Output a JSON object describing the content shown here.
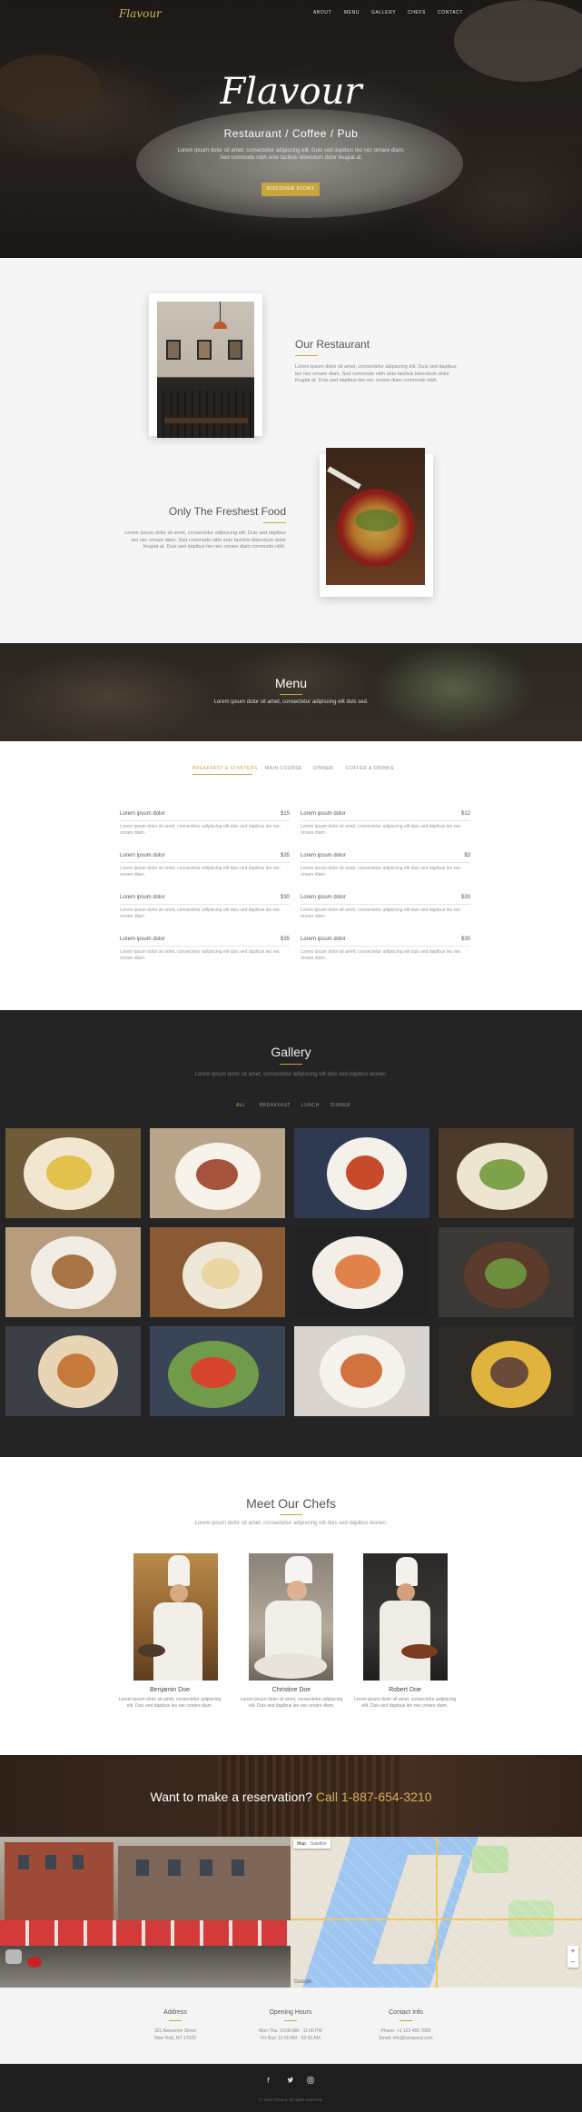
{
  "brand": {
    "logo": "Flavour",
    "accent": "#c9a53f"
  },
  "nav": {
    "items": [
      "ABOUT",
      "MENU",
      "GALLERY",
      "CHEFS",
      "CONTACT"
    ]
  },
  "hero": {
    "title": "Flavour",
    "subtitle": "Restaurant  /  Coffee  /  Pub",
    "description": "Lorem ipsum dolor sit amet, consectetur adipiscing elit. Duis sed dapibus leo nec ornare diam. Sed commodo nibh ante facilisis bibendum dolor feugiat at.",
    "button": "DISCOVER STORY"
  },
  "about": {
    "restaurant": {
      "heading": "Our Restaurant",
      "text": "Lorem ipsum dolor sit amet, consectetur adipiscing elit. Duis sed dapibus leo nec ornare diam. Sed commodo nibh ante facilisis bibendum dolor feugiat at. Duis sed dapibus leo nec ornare diam commodo nibh."
    },
    "food": {
      "heading": "Only The Freshest Food",
      "text": "Lorem ipsum dolor sit amet, consectetur adipiscing elit. Duis sed dapibus leo nec ornare diam. Sed commodo nibh ante facilisis bibendum dolor feugiat at. Duis sed dapibus leo nec ornare diam commodo nibh."
    }
  },
  "menu_banner": {
    "title": "Menu",
    "subtitle": "Lorem ipsum dolor sit amet, consectetur adipiscing elit duis sed."
  },
  "menu": {
    "tabs": [
      "BREAKFAST & STARTERS",
      "MAIN COURSE",
      "DINNER",
      "COFFEE & DRINKS"
    ],
    "active_tab": "BREAKFAST & STARTERS",
    "left": [
      {
        "name": "Lorem ipsum dolor",
        "price": "$15",
        "desc": "Lorem ipsum dolor sit amet, consectetur adipiscing elit duis sed dapibus leo nec ornare diam."
      },
      {
        "name": "Lorem ipsum dolor",
        "price": "$35",
        "desc": "Lorem ipsum dolor sit amet, consectetur adipiscing elit duis sed dapibus leo nec ornare diam."
      },
      {
        "name": "Lorem ipsum dolor",
        "price": "$30",
        "desc": "Lorem ipsum dolor sit amet, consectetur adipiscing elit duis sed dapibus leo nec ornare diam."
      },
      {
        "name": "Lorem ipsum dolor",
        "price": "$35",
        "desc": "Lorem ipsum dolor sit amet, consectetur adipiscing elit duis sed dapibus leo nec ornare diam."
      }
    ],
    "right": [
      {
        "name": "Lorem ipsum dolor",
        "price": "$12",
        "desc": "Lorem ipsum dolor sit amet, consectetur adipiscing elit duis sed dapibus leo nec ornare diam."
      },
      {
        "name": "Lorem ipsum dolor",
        "price": "$3",
        "desc": "Lorem ipsum dolor sit amet, consectetur adipiscing elit duis sed dapibus leo nec ornare diam."
      },
      {
        "name": "Lorem ipsum dolor",
        "price": "$33",
        "desc": "Lorem ipsum dolor sit amet, consectetur adipiscing elit duis sed dapibus leo nec ornare diam."
      },
      {
        "name": "Lorem ipsum dolor",
        "price": "$30",
        "desc": "Lorem ipsum dolor sit amet, consectetur adipiscing elit duis sed dapibus leo nec ornare diam."
      }
    ]
  },
  "gallery": {
    "title": "Gallery",
    "subtitle": "Lorem ipsum dolor sit amet, consectetur adipiscing elit duis sed dapibus leonec.",
    "tabs": [
      "ALL",
      "BREAKFAST",
      "LUNCH",
      "DINNER"
    ],
    "active_tab": "ALL",
    "photo_colors": [
      [
        "#6f5a3a",
        "#f1e6cf",
        "#e2c24c"
      ],
      [
        "#b8a58a",
        "#f7f2ea",
        "#a5533c"
      ],
      [
        "#2f3a52",
        "#f4f0ea",
        "#c74a2a"
      ],
      [
        "#4d3a2b",
        "#ede4d2",
        "#7fa34b"
      ],
      [
        "#b79c7e",
        "#f1ece4",
        "#a87446"
      ],
      [
        "#8a5a35",
        "#efe7d7",
        "#e9d6a3"
      ],
      [
        "#222222",
        "#f3eee7",
        "#e0834b"
      ],
      [
        "#3b3935",
        "#5b3b2b",
        "#6c8e3d"
      ],
      [
        "#3c3f46",
        "#e7d5b6",
        "#c57a3c"
      ],
      [
        "#3a4457",
        "#6f9b4a",
        "#d8452e"
      ],
      [
        "#d9d4cf",
        "#f6f3ef",
        "#d2723f"
      ],
      [
        "#2d2a27",
        "#e0b23e",
        "#6a4b3a"
      ]
    ]
  },
  "chefs": {
    "title": "Meet Our Chefs",
    "subtitle": "Lorem ipsum dolor sit amet, consectetur adipiscing elit duis sed dapibus leonec.",
    "list": [
      {
        "name": "Benjamin Doe",
        "desc": "Lorem ipsum dolor sit amet, consectetur adipiscing elit. Duis sed dapibus leo nec ornare diam."
      },
      {
        "name": "Christine Doe",
        "desc": "Lorem ipsum dolor sit amet, consectetur adipiscing elit. Duis sed dapibus leo nec ornare diam."
      },
      {
        "name": "Robert Doe",
        "desc": "Lorem ipsum dolor sit amet, consectetur adipiscing elit. Duis sed dapibus leo nec ornare diam."
      }
    ]
  },
  "reservation": {
    "text": "Want to make a reservation?",
    "phone": "Call 1-887-654-3210"
  },
  "map": {
    "type_map": "Map",
    "type_sat": "Satellite",
    "google": "Google"
  },
  "contact": {
    "address": {
      "title": "Address",
      "lines": [
        "321 Awesome Street",
        "New York, NY 17022"
      ]
    },
    "hours": {
      "title": "Opening Hours",
      "lines": [
        "Mon-Thu: 10:00 AM - 11:00 PM",
        "Fri-Sun: 11:00 AM - 02:00 AM"
      ]
    },
    "info": {
      "title": "Contact Info",
      "lines": [
        "Phone: +1 123 456 7890",
        "Email: info@company.com"
      ]
    }
  },
  "footer": {
    "social": [
      "facebook-icon",
      "twitter-icon",
      "instagram-icon"
    ],
    "copyright": "© 2016 Flavour. All rights reserved."
  }
}
